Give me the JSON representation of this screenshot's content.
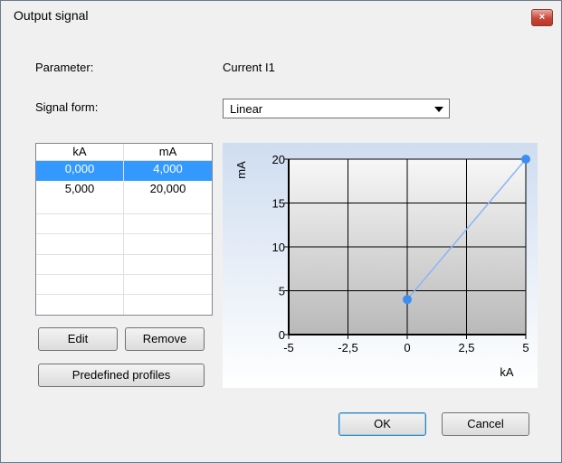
{
  "window": {
    "title": "Output signal",
    "close_label": "×"
  },
  "form": {
    "parameter_label": "Parameter:",
    "parameter_value": "Current I1",
    "signal_form_label": "Signal form:",
    "signal_form_value": "Linear"
  },
  "table": {
    "headers": [
      "kA",
      "mA"
    ],
    "rows": [
      {
        "ka": "0,000",
        "ma": "4,000",
        "selected": true
      },
      {
        "ka": "5,000",
        "ma": "20,000",
        "selected": false
      }
    ]
  },
  "buttons": {
    "edit": "Edit",
    "remove": "Remove",
    "predefined": "Predefined profiles",
    "ok": "OK",
    "cancel": "Cancel"
  },
  "chart_data": {
    "type": "line",
    "x": [
      0,
      5
    ],
    "y": [
      4,
      20
    ],
    "xlabel": "kA",
    "ylabel": "mA",
    "xlim": [
      -5,
      5
    ],
    "ylim": [
      0,
      20
    ],
    "x_ticks": [
      "-5",
      "-2,5",
      "0",
      "2,5",
      "5"
    ],
    "y_ticks": [
      "0",
      "5",
      "10",
      "15",
      "20"
    ],
    "grid": true,
    "line_color": "#8ab4f8",
    "point_color": "#3d8ef2"
  }
}
